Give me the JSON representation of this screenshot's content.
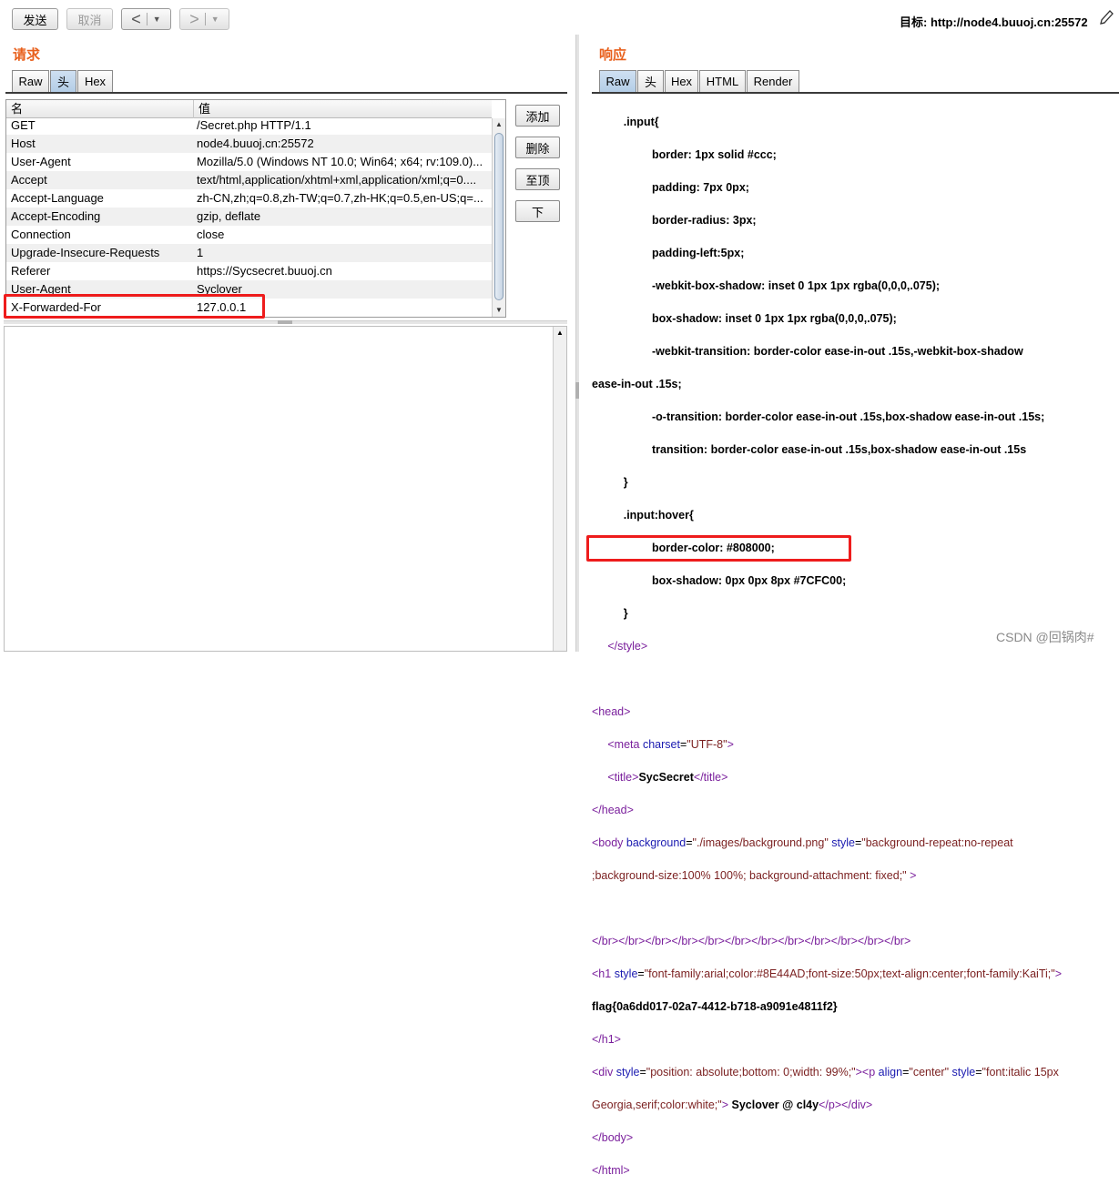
{
  "toolbar": {
    "send_label": "发送",
    "cancel_label": "取消",
    "back_label": "<",
    "forward_label": ">",
    "target_label": "目标: http://node4.buuoj.cn:25572"
  },
  "request": {
    "title": "请求",
    "tabs": [
      "Raw",
      "头",
      "Hex"
    ],
    "active_tab": "头",
    "columns": [
      "名",
      "值"
    ],
    "headers": [
      {
        "name": "GET",
        "value": "/Secret.php HTTP/1.1"
      },
      {
        "name": "Host",
        "value": "node4.buuoj.cn:25572"
      },
      {
        "name": "User-Agent",
        "value": "Mozilla/5.0 (Windows NT 10.0; Win64; x64; rv:109.0)..."
      },
      {
        "name": "Accept",
        "value": "text/html,application/xhtml+xml,application/xml;q=0...."
      },
      {
        "name": "Accept-Language",
        "value": "zh-CN,zh;q=0.8,zh-TW;q=0.7,zh-HK;q=0.5,en-US;q=..."
      },
      {
        "name": "Accept-Encoding",
        "value": "gzip, deflate"
      },
      {
        "name": "Connection",
        "value": "close"
      },
      {
        "name": "Upgrade-Insecure-Requests",
        "value": "1"
      },
      {
        "name": "Referer",
        "value": "https://Sycsecret.buuoj.cn"
      },
      {
        "name": "User-Agent",
        "value": "Syclover"
      },
      {
        "name": "X-Forwarded-For",
        "value": "127.0.0.1"
      }
    ],
    "side_buttons": [
      "添加",
      "删除",
      "至顶",
      "下"
    ]
  },
  "response": {
    "title": "响应",
    "tabs": [
      "Raw",
      "头",
      "Hex",
      "HTML",
      "Render"
    ],
    "active_tab": "Raw",
    "flag": "flag{0a6dd017-02a7-4412-b718-a9091e4811f2}"
  },
  "watermark": "CSDN @回锅肉#"
}
